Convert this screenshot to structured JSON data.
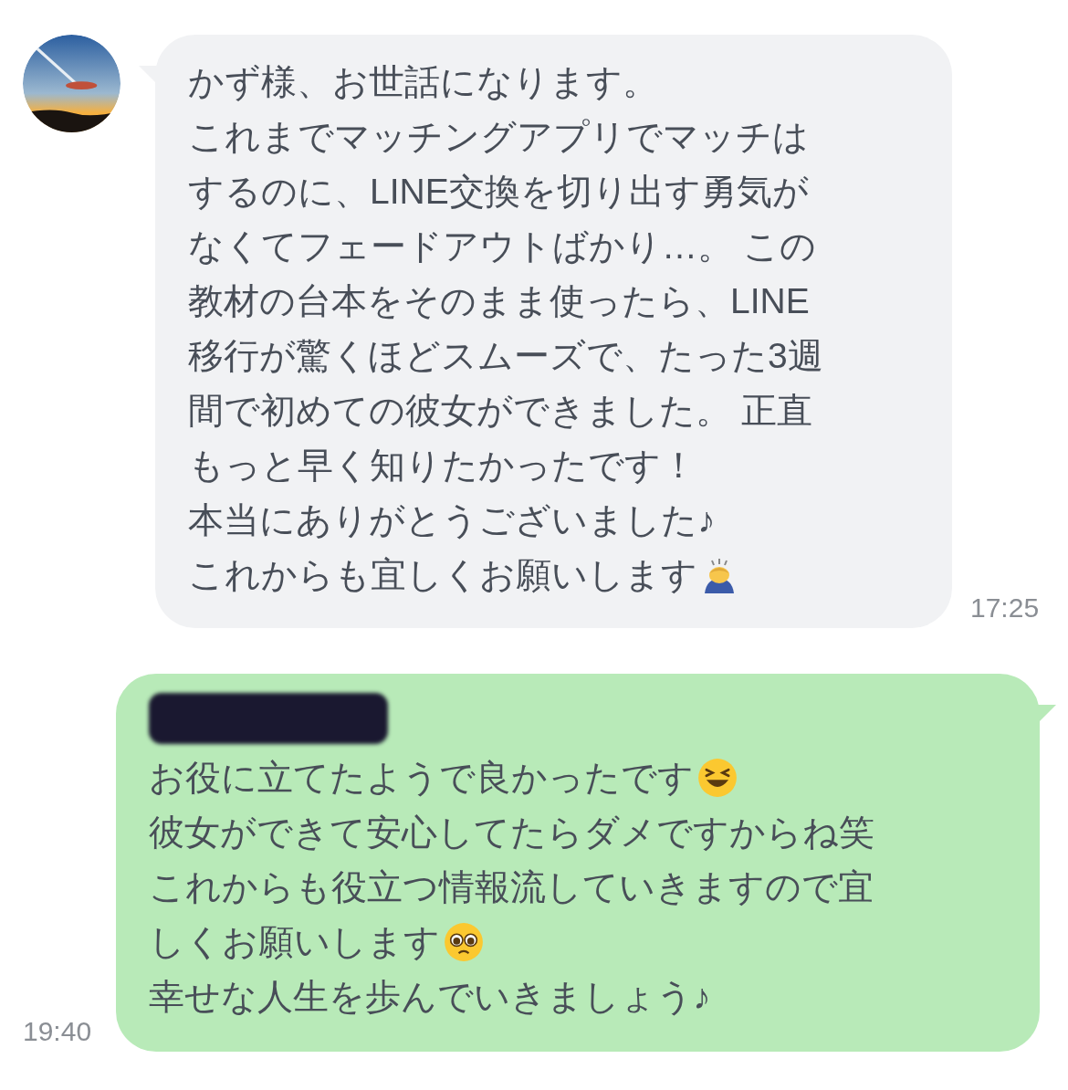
{
  "messages": [
    {
      "kind": "incoming",
      "time": "17:25",
      "redacted_name": false,
      "lines": [
        {
          "text": "かず様、お世話になります。"
        },
        {
          "text": "これまでマッチングアプリでマッチは"
        },
        {
          "text": "するのに、LINE交換を切り出す勇気が"
        },
        {
          "text": "なくてフェードアウトばかり…。 この"
        },
        {
          "text": "教材の台本をそのまま使ったら、LINE"
        },
        {
          "text": "移行が驚くほどスムーズで、たった3週"
        },
        {
          "text": "間で初めての彼女ができました。 正直"
        },
        {
          "text": "もっと早く知りたかったです！"
        },
        {
          "text": "本当にありがとうございました♪"
        },
        {
          "text": "これからも宜しくお願いします",
          "kind": "bowing"
        }
      ]
    },
    {
      "kind": "outgoing",
      "time": "19:40",
      "redacted_name": true,
      "lines": [
        {
          "text": "お役に立てたようで良かったです",
          "kind": "grinning"
        },
        {
          "text": "彼女ができて安心してたらダメですからね笑"
        },
        {
          "text": "これからも役立つ情報流していきますので宜"
        },
        {
          "text": "しくお願いします",
          "kind": "pleading"
        },
        {
          "text": "幸せな人生を歩んでいきましょう♪"
        }
      ]
    }
  ]
}
